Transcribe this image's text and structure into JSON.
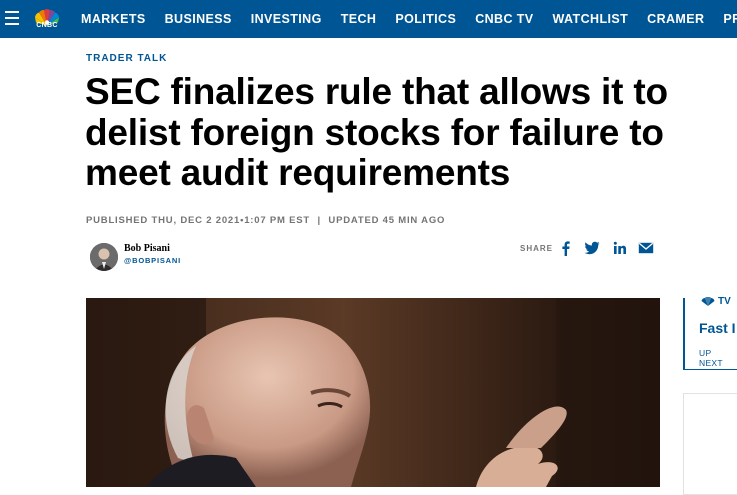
{
  "nav": {
    "logo_text": "CNBC",
    "items": [
      "MARKETS",
      "BUSINESS",
      "INVESTING",
      "TECH",
      "POLITICS",
      "CNBC TV",
      "WATCHLIST",
      "CRAMER",
      "PRO"
    ],
    "pro_icon": "lock-icon",
    "menu_icon": "hamburger-menu-icon"
  },
  "article": {
    "kicker": "TRADER TALK",
    "headline_lines": [
      "SEC finalizes rule that allows it to",
      "delist foreign stocks for failure to",
      "meet audit requirements"
    ],
    "published": "PUBLISHED THU, DEC 2 2021•1:07 PM EST",
    "updated": "UPDATED 45 MIN AGO",
    "separator": "|",
    "author": {
      "name": "Bob Pisani",
      "handle": "@BOBPISANI"
    },
    "share": {
      "label": "SHARE",
      "icons": [
        "facebook-icon",
        "twitter-icon",
        "linkedin-icon",
        "email-icon"
      ]
    }
  },
  "rail": {
    "tv_label": "TV",
    "title": "Fast I",
    "subtitle": "UP NEXT"
  },
  "colors": {
    "brand_blue": "#005594",
    "text_black": "#000000",
    "meta_gray": "#747474"
  }
}
